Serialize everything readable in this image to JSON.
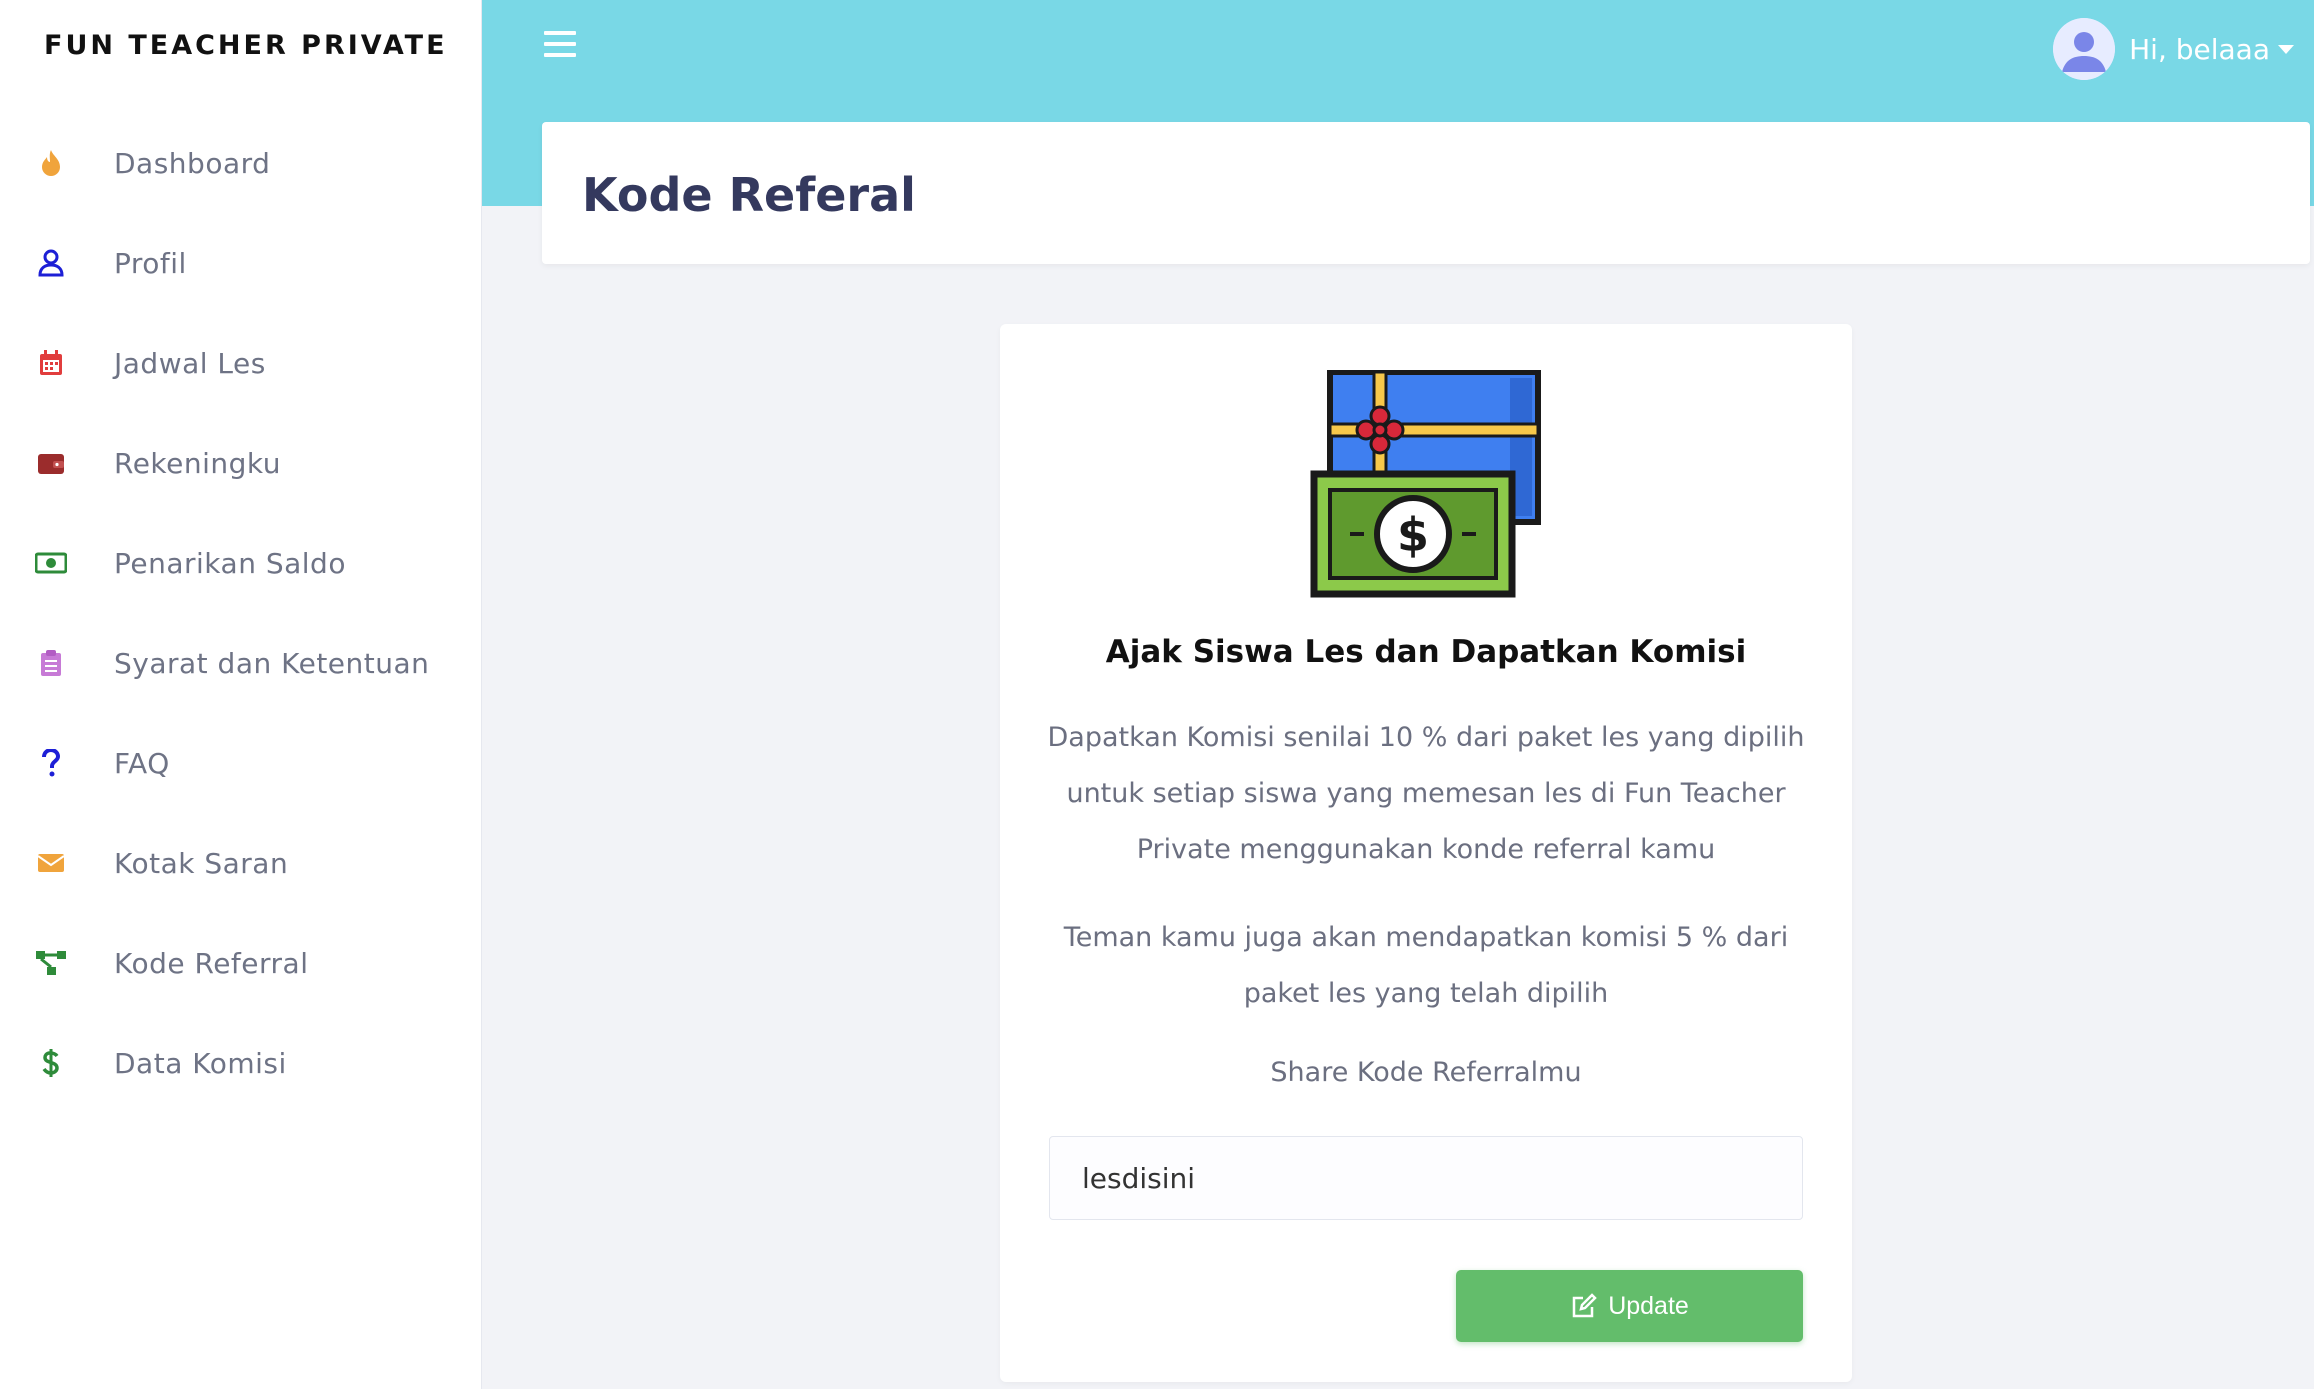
{
  "brand": "FUN TEACHER PRIVATE",
  "sidebar": {
    "items": [
      {
        "label": "Dashboard",
        "icon": "fire-icon",
        "color": "#f0a43c"
      },
      {
        "label": "Profil",
        "icon": "user-icon",
        "color": "#1d1fd6"
      },
      {
        "label": "Jadwal Les",
        "icon": "calendar-icon",
        "color": "#e13d3d"
      },
      {
        "label": "Rekeningku",
        "icon": "wallet-icon",
        "color": "#9b2c2c"
      },
      {
        "label": "Penarikan Saldo",
        "icon": "money-bill-icon",
        "color": "#2e8b3a"
      },
      {
        "label": "Syarat dan Ketentuan",
        "icon": "clipboard-list-icon",
        "color": "#c77ad6"
      },
      {
        "label": "FAQ",
        "icon": "question-icon",
        "color": "#1d1fd6"
      },
      {
        "label": "Kotak Saran",
        "icon": "envelope-icon",
        "color": "#f0a43c"
      },
      {
        "label": "Kode Referral",
        "icon": "sitemap-icon",
        "color": "#2e8b3a"
      },
      {
        "label": "Data Komisi",
        "icon": "dollar-icon",
        "color": "#2e8b3a"
      }
    ]
  },
  "header": {
    "menu_icon": "hamburger-icon",
    "user_greeting": "Hi, belaaa",
    "accent": "#79d8e6"
  },
  "page": {
    "title": "Kode Referal"
  },
  "card": {
    "image_icon": "gift-money-icon",
    "title": "Ajak Siswa Les dan Dapatkan Komisi",
    "paragraph1": "Dapatkan Komisi senilai 10 % dari paket les yang dipilih untuk setiap siswa yang memesan les di Fun Teacher Private menggunakan konde referral kamu",
    "paragraph2": "Teman kamu juga akan mendapatkan komisi 5 % dari paket les yang telah dipilih",
    "share_label": "Share Kode Referralmu",
    "referral_code": "lesdisini",
    "update_label": "Update",
    "button_color": "#63bd6b"
  }
}
